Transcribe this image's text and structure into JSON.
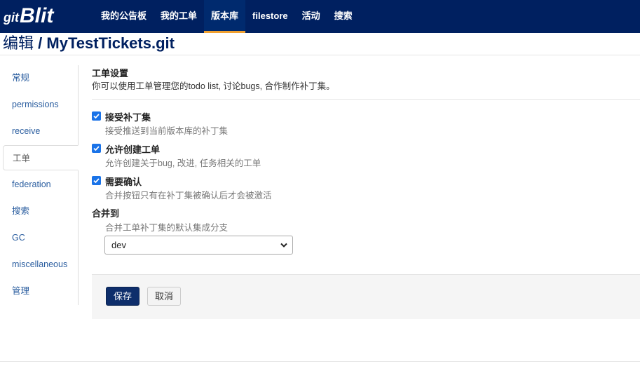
{
  "brand": {
    "prefix": "git",
    "name": "Blit"
  },
  "nav": [
    {
      "label": "我的公告板",
      "active": false
    },
    {
      "label": "我的工单",
      "active": false
    },
    {
      "label": "版本库",
      "active": true
    },
    {
      "label": "filestore",
      "active": false
    },
    {
      "label": "活动",
      "active": false
    },
    {
      "label": "搜索",
      "active": false
    }
  ],
  "page": {
    "edit_label": "编辑",
    "separator": "/",
    "repo_name": "MyTestTickets.git"
  },
  "sidebar": {
    "items": [
      {
        "label": "常规",
        "active": false
      },
      {
        "label": "permissions",
        "active": false
      },
      {
        "label": "receive",
        "active": false
      },
      {
        "label": "工单",
        "active": true
      },
      {
        "label": "federation",
        "active": false
      },
      {
        "label": "搜索",
        "active": false
      },
      {
        "label": "GC",
        "active": false
      },
      {
        "label": "miscellaneous",
        "active": false
      },
      {
        "label": "管理",
        "active": false
      }
    ]
  },
  "tickets": {
    "title": "工单设置",
    "description": "你可以使用工单管理您的todo list, 讨论bugs, 合作制作补丁集。",
    "options": [
      {
        "label": "接受补丁集",
        "description": "接受推送到当前版本库的补丁集",
        "checked": true
      },
      {
        "label": "允许创建工单",
        "description": "允许创建关于bug, 改进, 任务相关的工单",
        "checked": true
      },
      {
        "label": "需要确认",
        "description": "合并按钮只有在补丁集被确认后才会被激活",
        "checked": true
      }
    ],
    "merge_to": {
      "label": "合并到",
      "description": "合并工单补丁集的默认集成分支",
      "selected": "dev"
    }
  },
  "actions": {
    "save": "保存",
    "cancel": "取消"
  },
  "colors": {
    "navbar": "#002060",
    "nav_active_underline": "#f0a030",
    "link": "#2a5d9f",
    "checkbox": "#1a73e8",
    "primary_button": "#0e2e6b"
  }
}
